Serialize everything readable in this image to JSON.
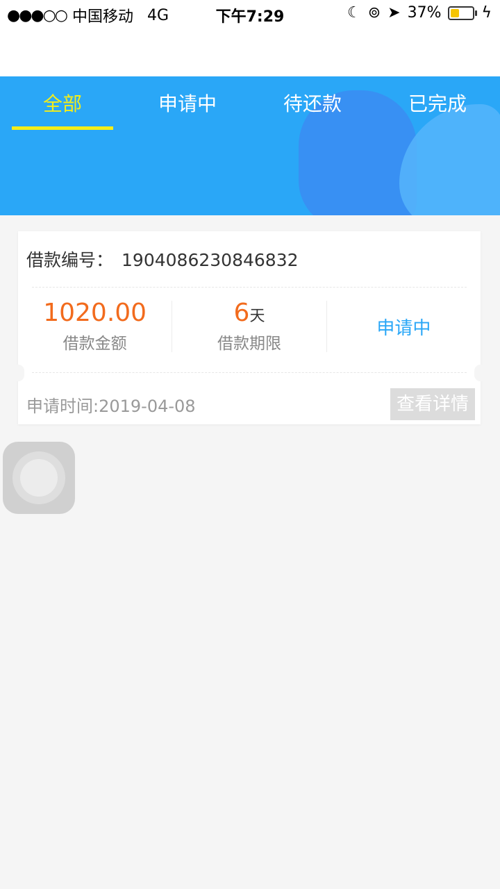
{
  "status_bar": {
    "signal": "●●●○○",
    "carrier": "中国移动",
    "network": "4G",
    "time": "下午7:29",
    "battery": "37%",
    "icons": [
      "moon-icon",
      "rotation-lock-icon",
      "location-arrow-icon",
      "battery-icon",
      "charging-icon"
    ]
  },
  "tabs": [
    {
      "label": "全部",
      "active": true
    },
    {
      "label": "申请中",
      "active": false
    },
    {
      "label": "待还款",
      "active": false
    },
    {
      "label": "已完成",
      "active": false
    }
  ],
  "colors": {
    "header": "#2aa7f7",
    "active_tab": "#f4ee19",
    "amount": "#f26b1d",
    "status": "#2aa7f7"
  },
  "loan": {
    "number_label": "借款编号：",
    "number": "1904086230846832",
    "amount": "1020.00",
    "amount_label": "借款金额",
    "term_value": "6",
    "term_unit": "天",
    "term_label": "借款期限",
    "status": "申请中",
    "apply_time": "申请时间:2019-04-08",
    "detail_button": "查看详情"
  }
}
